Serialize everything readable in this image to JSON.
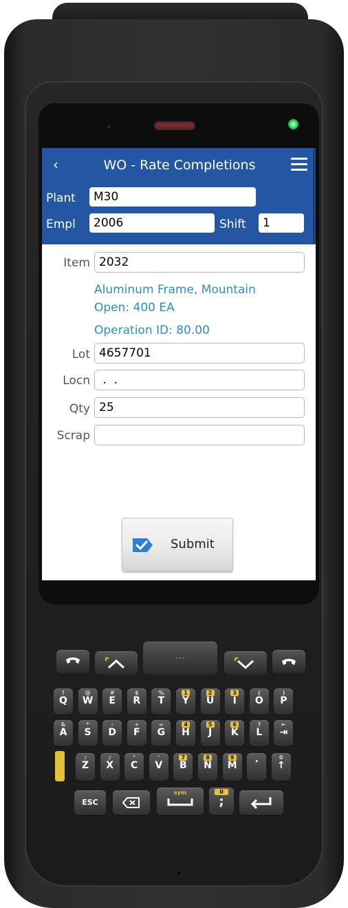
{
  "app": {
    "title": "WO - Rate Completions"
  },
  "header": {
    "plant_label": "Plant",
    "plant_value": "M30",
    "empl_label": "Empl",
    "empl_value": "2006",
    "shift_label": "Shift",
    "shift_value": "1"
  },
  "form": {
    "item_label": "Item",
    "item_value": "2032",
    "item_description": "Aluminum Frame, Mountain",
    "open_qty": "Open: 400  EA",
    "operation_id": "Operation ID: 80.00",
    "lot_label": "Lot",
    "lot_value": "4657701",
    "locn_label": "Locn",
    "locn_value": " .  .",
    "qty_label": "Qty",
    "qty_value": "25",
    "scrap_label": "Scrap",
    "scrap_value": ""
  },
  "actions": {
    "submit_label": "Submit"
  },
  "keypad": {
    "nav": [
      "...",
      ""
    ],
    "row1": [
      {
        "ch": "Q",
        "sub": "!"
      },
      {
        "ch": "W",
        "sub": "@"
      },
      {
        "ch": "E",
        "sub": "#"
      },
      {
        "ch": "R",
        "sub": "$"
      },
      {
        "ch": "T",
        "sub": "%"
      },
      {
        "ch": "Y",
        "sub": "1"
      },
      {
        "ch": "U",
        "sub": "2"
      },
      {
        "ch": "I",
        "sub": "3"
      },
      {
        "ch": "O",
        "sub": "("
      },
      {
        "ch": "P",
        "sub": ")"
      }
    ],
    "row2": [
      {
        "ch": "A",
        "sub": "&"
      },
      {
        "ch": "S",
        "sub": "*"
      },
      {
        "ch": "D",
        "sub": "-"
      },
      {
        "ch": "F",
        "sub": "+"
      },
      {
        "ch": "G",
        "sub": "="
      },
      {
        "ch": "H",
        "sub": "4"
      },
      {
        "ch": "J",
        "sub": "5"
      },
      {
        "ch": "K",
        "sub": "6"
      },
      {
        "ch": "L",
        "sub": "?"
      },
      {
        "ch": "⇥",
        "sub": "⇤"
      }
    ],
    "row3": [
      {
        "ch": "Z",
        "sub": ":"
      },
      {
        "ch": "X",
        "sub": "/"
      },
      {
        "ch": "C",
        "sub": "\""
      },
      {
        "ch": "V",
        "sub": "'"
      },
      {
        "ch": "B",
        "sub": "7"
      },
      {
        "ch": "N",
        "sub": "8"
      },
      {
        "ch": "M",
        "sub": "9"
      },
      {
        "ch": ".",
        "sub": ""
      },
      {
        "ch": "↑",
        "sub": "0"
      }
    ],
    "row4": {
      "esc": "ESC",
      "sym": "sym",
      "semi": ";",
      "semi_sub": "0"
    }
  },
  "colors": {
    "header_bg": "#2457a3",
    "info_text": "#2b8bd6",
    "status_led": "#2ee36b",
    "fn_key": "#e3c135"
  }
}
